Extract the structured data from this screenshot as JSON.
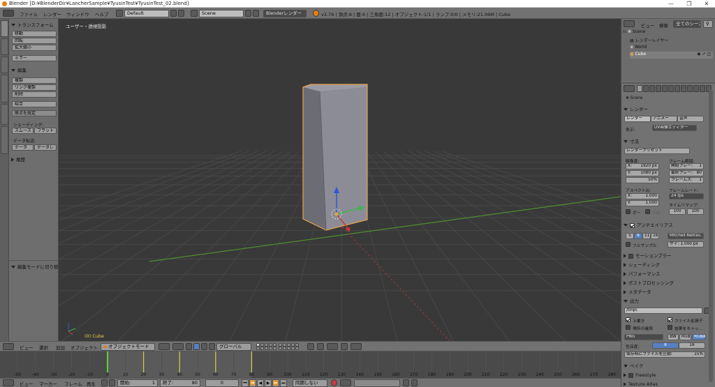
{
  "window": {
    "title": "Blender [D:¥BlenderDir¥LancherSample¥TyusinTest¥TyusinTest_02.blend]",
    "minimize": "—",
    "maximize": "❐",
    "close": "✕"
  },
  "topbar": {
    "menus": [
      "ファイル",
      "レンダー",
      "ウィンドウ",
      "ヘルプ"
    ],
    "screen_layout": "Default",
    "scene": "Scene",
    "engine": "Blenderレンダー",
    "stats": "v2.79 | 頂点:8 | 面:6 | 三角面:12 | オブジェクト:1/1 | ランプ:0/0 | メモリ:21.06M | Cube"
  },
  "shelf": {
    "transform_header": "トランスフォーム",
    "transform_buttons": [
      "移動",
      "回転",
      "拡大縮小"
    ],
    "mirror": "ミラー",
    "edit_header": "編集",
    "edit_buttons": [
      "複製",
      "リンク複製",
      "削除"
    ],
    "join": "結合",
    "set_origin": "原点を設定",
    "shading_label": "シェーディング:",
    "smooth": "スムーズ",
    "flat": "フラット",
    "data_transfer_label": "データ転送:",
    "data": "データ",
    "data_layers": "データレ",
    "history_header": "履歴",
    "operator_header": "編集モードに切り替え",
    "tabs": [
      "ツール",
      "作成",
      "関係",
      "アニメーション",
      "物理演算",
      "Grease Pencil"
    ]
  },
  "viewport": {
    "view_label": "ユーザー・透視投影",
    "object_label": "(0) Cube",
    "colors": {
      "background": "#393939",
      "grid": "#474747",
      "x_axis": "#8b3a3a",
      "y_axis": "#4f8f2f",
      "cube_front": "#8c8c96",
      "cube_side": "#6c6c74",
      "cube_top": "#9a9aa4",
      "selection": "#e8a34b"
    }
  },
  "viewport_header": {
    "menus": [
      "ビュー",
      "選択",
      "追加",
      "オブジェクト"
    ],
    "mode": "オブジェクトモード",
    "orientation": "グローバル"
  },
  "timeline": {
    "ticks": [
      "-50",
      "-40",
      "-30",
      "-20",
      "-10",
      "0",
      "10",
      "20",
      "30",
      "40",
      "50",
      "60",
      "70",
      "80",
      "90",
      "100",
      "110",
      "120",
      "130",
      "140",
      "150",
      "160",
      "170",
      "180",
      "190",
      "200",
      "210",
      "220",
      "230",
      "240",
      "250",
      "260",
      "270",
      "280"
    ],
    "current_frame": 0,
    "keyframes": [
      20,
      40,
      60,
      80
    ],
    "menus": [
      "ビュー",
      "マーカー",
      "フレーム",
      "再生"
    ],
    "start_label": "開始:",
    "start": "1",
    "end_label": "終了:",
    "end": "80",
    "frame": "0",
    "sync": "同期しない"
  },
  "outliner": {
    "view": "ビュー",
    "search": "検索",
    "filter": "全てのシーン",
    "items": [
      "Scene",
      "レンダーレイヤー",
      "World",
      "Cube"
    ]
  },
  "properties": {
    "scene": "Scene",
    "render_header": "レンダー",
    "render_btn": "レンダー",
    "anim_btn": "アニメー",
    "audio_btn": "音声",
    "display_label": "表示:",
    "display_value": "UV画像エディター",
    "dimensions_header": "寸法",
    "render_presets": "レンダープリセット",
    "resolution_label": "解像度:",
    "res_x": "X:",
    "res_x_val": "1920 px",
    "res_y": "Y:",
    "res_y_val": "1080 px",
    "res_pct": "50%",
    "frame_range_label": "フレーム範囲:",
    "start_frame": "開始フレー:",
    "start_frame_val": "1",
    "end_frame": "最終フレー:",
    "end_frame_val": "80",
    "frame_step": "フレームス:",
    "frame_step_val": "1",
    "aspect_label": "アスペクト比:",
    "asp_x": "X:",
    "asp_x_val": "1.000",
    "asp_y": "Y:",
    "asp_y_val": "1.000",
    "framerate_label": "フレームレート:",
    "fps": "24 fps",
    "timeremap_label": "タイムリマップ:",
    "remap_old": "100",
    "remap_new": "100",
    "border": "ボー",
    "crop": "クロ",
    "aa_header": "アンチエイリアス",
    "aa_samples": [
      "5",
      "8",
      "11",
      "16"
    ],
    "aa_filter": "Mitchell-Netrav...",
    "full_sample": "フルサンプル",
    "aa_size": "サイ: 1.000 px",
    "collapsed_panels": [
      "モーションブラー",
      "シェーディング",
      "パフォーマンス",
      "ポストプロセッシング",
      "メタデータ"
    ],
    "output_header": "出力",
    "output_path": "/tmp\\",
    "overwrite": "上書き",
    "file_ext": "ファイル拡張子",
    "placeholders": "場所の確保",
    "cache_result": "結果をキャッ...",
    "format": "PNG",
    "bw": "BW",
    "rgb": "RGB",
    "rgba": "RGBA",
    "color_depth_label": "色深度:",
    "depth_8": "8",
    "depth_16": "16",
    "compression": "保存時にファイルを圧縮:",
    "compression_val": "15%",
    "bake_header": "ベイク",
    "freestyle": "Freestyle",
    "texture_atlas": "Texture Atlas"
  }
}
